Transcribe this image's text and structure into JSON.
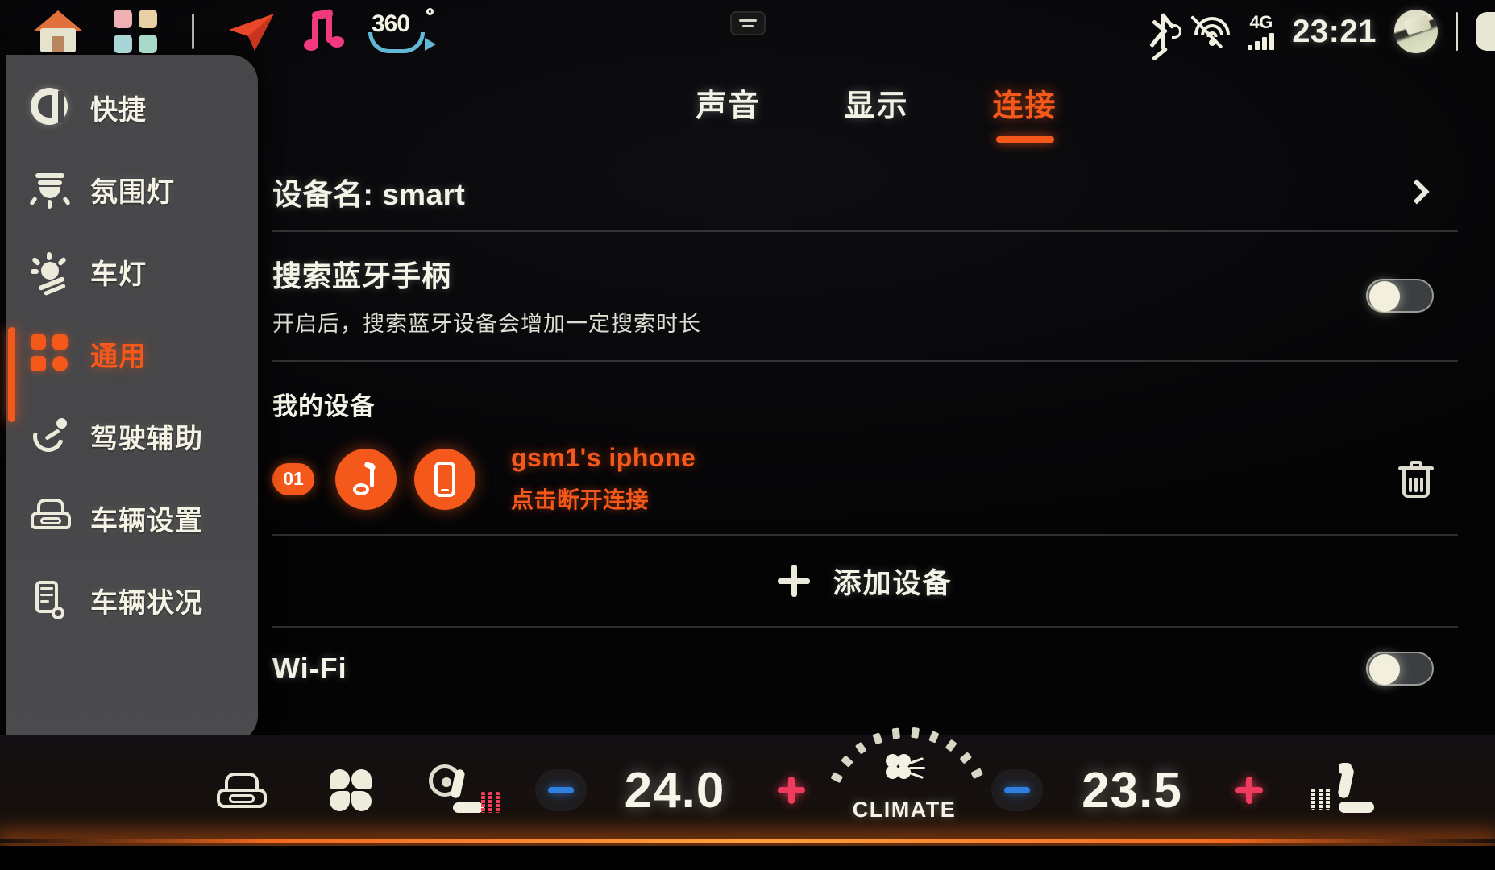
{
  "statusbar": {
    "icons_left": [
      "home-icon",
      "apps-grid-icon",
      "divider",
      "navigation-icon",
      "music-icon",
      "360-view-icon"
    ],
    "label_360": "360",
    "center_icon": "menu-handle-icon",
    "bluetooth_icon": "bluetooth-icon",
    "wifi_off_icon": "wifi-off-icon",
    "network_label": "4G",
    "time": "23:21",
    "avatar": "user-avatar"
  },
  "sidebar": {
    "items": [
      {
        "label": "快捷",
        "icon": "quick-access-icon",
        "active": false
      },
      {
        "label": "氛围灯",
        "icon": "ambient-light-icon",
        "active": false
      },
      {
        "label": "车灯",
        "icon": "headlight-icon",
        "active": false
      },
      {
        "label": "通用",
        "icon": "general-grid-icon",
        "active": true
      },
      {
        "label": "驾驶辅助",
        "icon": "driving-assist-icon",
        "active": false
      },
      {
        "label": "车辆设置",
        "icon": "vehicle-settings-icon",
        "active": false
      },
      {
        "label": "车辆状况",
        "icon": "vehicle-status-icon",
        "active": false
      }
    ]
  },
  "tabs": [
    {
      "label": "声音",
      "active": false
    },
    {
      "label": "显示",
      "active": false
    },
    {
      "label": "连接",
      "active": true
    }
  ],
  "content": {
    "device_name_row": {
      "label": "设备名: smart",
      "chevron": "chevron-right-icon"
    },
    "bt_search_row": {
      "title": "搜索蓝牙手柄",
      "subtitle": "开启后，搜索蓝牙设备会增加一定搜索时长",
      "toggle_state": "off"
    },
    "my_devices_header": "我的设备",
    "devices": [
      {
        "index": "01",
        "name": "gsm1's iphone",
        "status": "点击断开连接",
        "icons": [
          "audio-profile-icon",
          "phone-profile-icon"
        ],
        "delete_icon": "trash-icon"
      }
    ],
    "add_device": {
      "label": "添加设备",
      "icon": "plus-icon"
    },
    "wifi_row": {
      "label": "Wi-Fi",
      "toggle_state": "off"
    }
  },
  "climate": {
    "defrost_icon": "windshield-defrost-icon",
    "fan_icon": "fan-icon",
    "steering_seat_heat_icon": "steering-wheel-seat-heat-icon",
    "driver": {
      "minus": "−",
      "value": "24.0",
      "plus": "+"
    },
    "center_label": "CLIMATE",
    "passenger": {
      "minus": "−",
      "value": "23.5",
      "plus": "+"
    },
    "seat_heat_icon": "seat-heat-icon"
  },
  "colors": {
    "accent_orange": "#f4581a",
    "text_cream": "#f4f3e7",
    "sidebar_bg": "#47474a",
    "minus_blue": "#2f7fe0",
    "plus_red": "#ef3b5e"
  }
}
